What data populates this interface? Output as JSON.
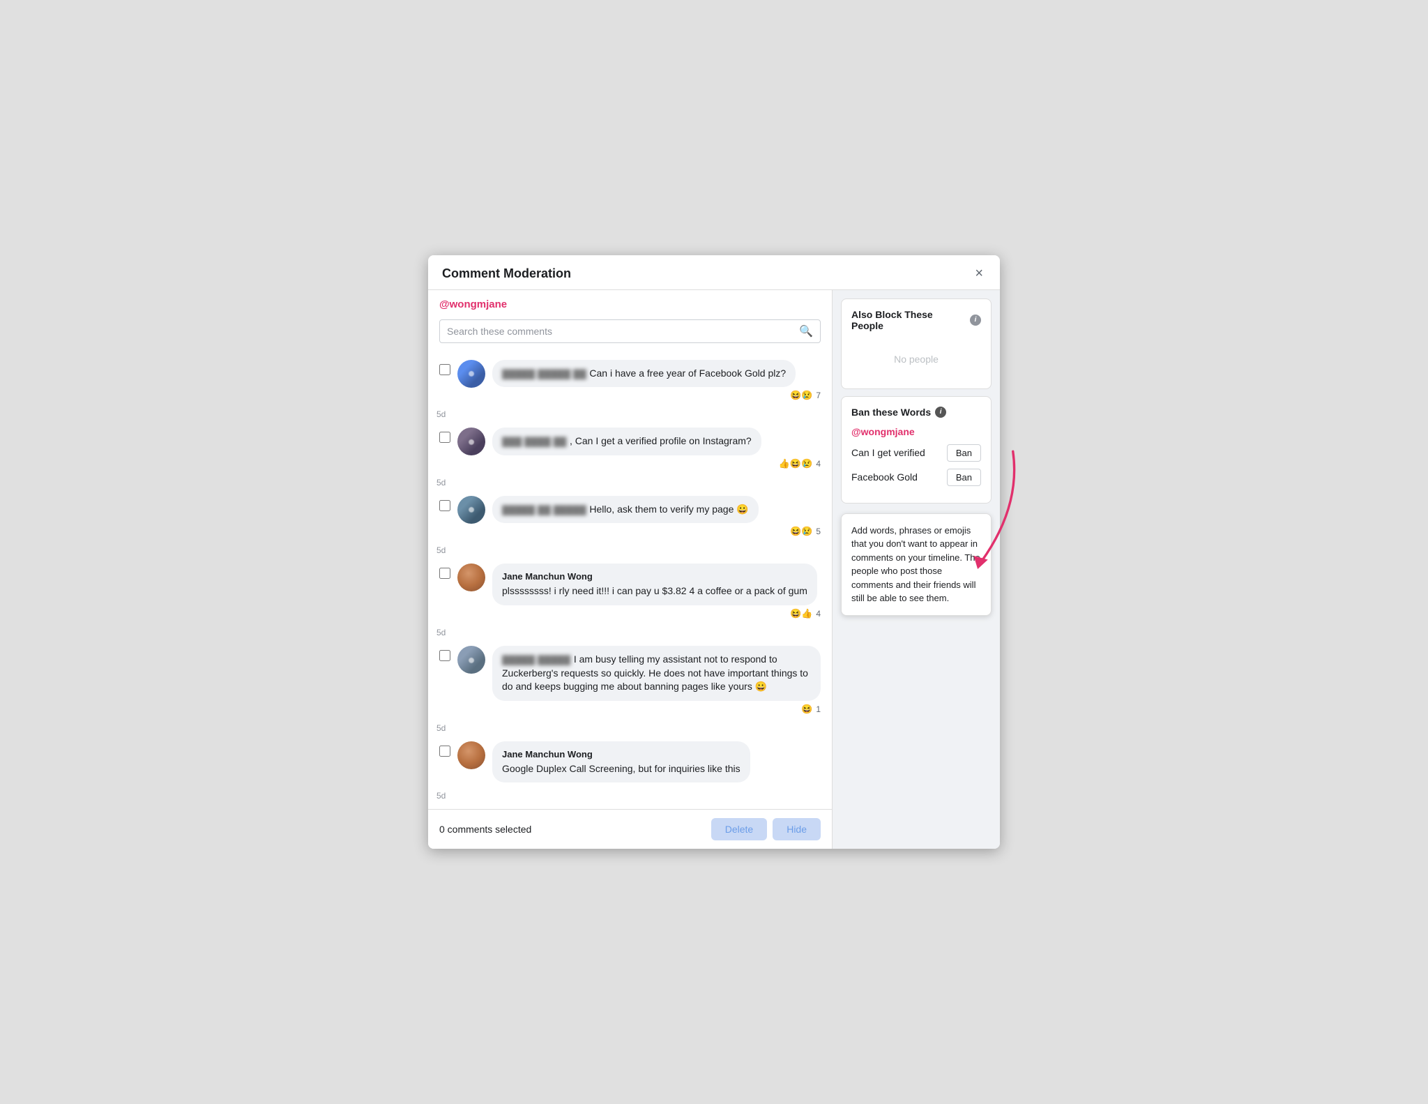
{
  "modal": {
    "title": "Comment Moderation",
    "close_label": "×"
  },
  "left_panel": {
    "username": "@wongmjane",
    "search_placeholder": "Search these comments",
    "comments": [
      {
        "id": 1,
        "author_type": "blurred",
        "author_name": "",
        "text": "Can i have a free year of Facebook Gold plz?",
        "reactions": "😆😢",
        "reaction_count": "7",
        "time": "5d",
        "checked": false
      },
      {
        "id": 2,
        "author_type": "blurred",
        "author_name": "",
        "text": "Can I get a verified profile on Instagram?",
        "reactions": "👍😆😢",
        "reaction_count": "4",
        "time": "5d",
        "checked": false
      },
      {
        "id": 3,
        "author_type": "blurred",
        "author_name": "",
        "text": "Hello, ask them to verify my page 😀",
        "reactions": "😆😢",
        "reaction_count": "5",
        "time": "5d",
        "checked": false
      },
      {
        "id": 4,
        "author_type": "real",
        "author_name": "Jane Manchun Wong",
        "text": "plsssssss! i rly need it!!! i can pay u $3.82 4 a coffee or a pack of gum",
        "reactions": "😆👍",
        "reaction_count": "4",
        "time": "5d",
        "checked": false
      },
      {
        "id": 5,
        "author_type": "blurred",
        "author_name": "",
        "text": "I am busy telling my assistant not to respond to Zuckerberg's requests so quickly. He does not have important things to do and keeps bugging me about banning pages like yours 😀",
        "reactions": "😆",
        "reaction_count": "1",
        "time": "5d",
        "checked": false
      },
      {
        "id": 6,
        "author_type": "real",
        "author_name": "Jane Manchun Wong",
        "text": "Google Duplex Call Screening, but for inquiries like this",
        "reactions": "",
        "reaction_count": "",
        "time": "5d",
        "checked": false
      }
    ],
    "selected_count": "0 comments selected",
    "delete_label": "Delete",
    "hide_label": "Hide"
  },
  "right_panel": {
    "also_block": {
      "title": "Also Block These People",
      "no_people": "No people"
    },
    "ban_words": {
      "title": "Ban these Words",
      "username": "@wongmjane",
      "words": [
        {
          "label": "Can I get verified",
          "button": "Ban"
        },
        {
          "label": "Facebook Gold",
          "button": "Ban"
        }
      ]
    },
    "tooltip": {
      "text": "Add words, phrases or emojis that you don't want to appear in comments on your timeline. The people who post those comments and their friends will still be able to see them."
    }
  },
  "icons": {
    "search": "🔍",
    "info": "i",
    "close": "×"
  }
}
